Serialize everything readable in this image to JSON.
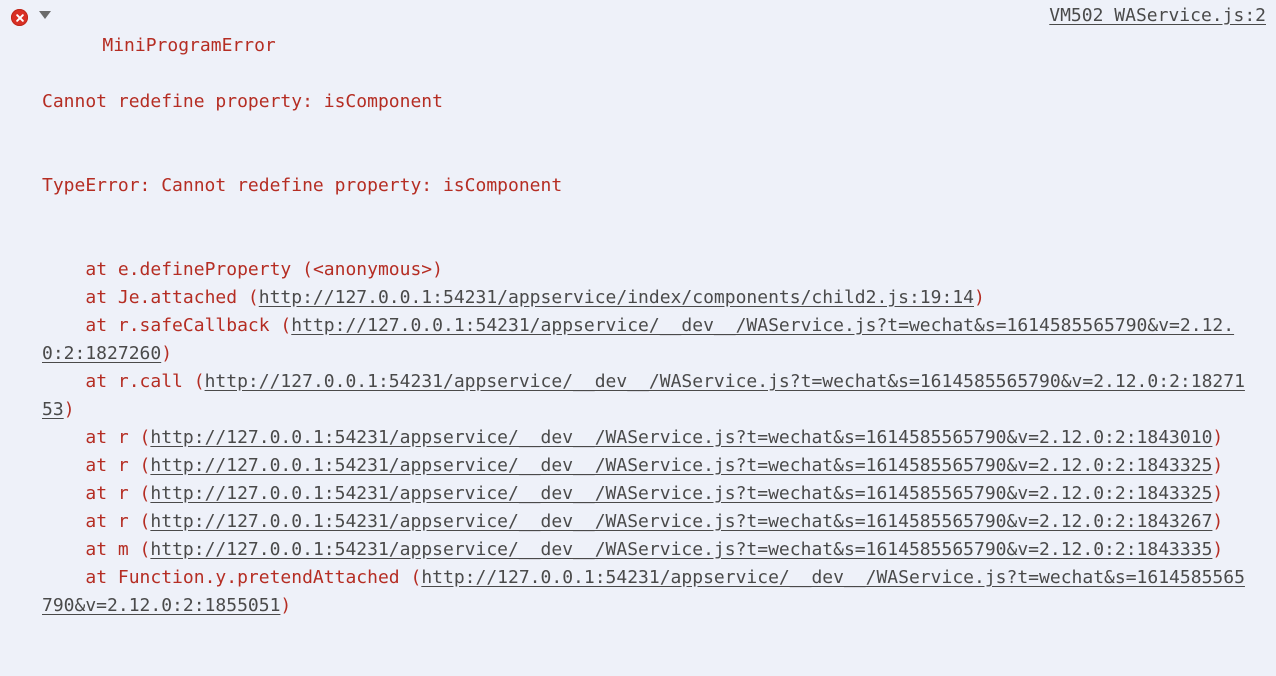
{
  "panel": {
    "type": "devtools-console-error-entry",
    "background_color": "#eef1f9",
    "error_text_color": "#b52d23",
    "link_color": "#4a4a4a",
    "icon_color": "#d93025"
  },
  "icons": {
    "error": "error-circle-x-icon",
    "disclosure": "triangle-down-icon"
  },
  "source_reference": {
    "label": "VM502 WAService.js:2"
  },
  "error": {
    "title": "MiniProgramError",
    "message": "Cannot redefine property: isComponent",
    "type_line": "TypeError: Cannot redefine property: isComponent",
    "stack": [
      {
        "prefix": "    at e.defineProperty (",
        "url": "",
        "location": "<anonymous>",
        "suffix": ")"
      },
      {
        "prefix": "    at Je.attached (",
        "url": "http://127.0.0.1:54231/appservice/index/components/child2.js:19:14",
        "suffix": ")"
      },
      {
        "prefix": "    at r.safeCallback (",
        "url": "http://127.0.0.1:54231/appservice/__dev__/WAService.js?t=wechat&s=1614585565790&v=2.12.0:2:1827260",
        "suffix": ")"
      },
      {
        "prefix": "    at r.call (",
        "url": "http://127.0.0.1:54231/appservice/__dev__/WAService.js?t=wechat&s=1614585565790&v=2.12.0:2:1827153",
        "suffix": ")"
      },
      {
        "prefix": "    at r (",
        "url": "http://127.0.0.1:54231/appservice/__dev__/WAService.js?t=wechat&s=1614585565790&v=2.12.0:2:1843010",
        "suffix": ")"
      },
      {
        "prefix": "    at r (",
        "url": "http://127.0.0.1:54231/appservice/__dev__/WAService.js?t=wechat&s=1614585565790&v=2.12.0:2:1843325",
        "suffix": ")"
      },
      {
        "prefix": "    at r (",
        "url": "http://127.0.0.1:54231/appservice/__dev__/WAService.js?t=wechat&s=1614585565790&v=2.12.0:2:1843325",
        "suffix": ")"
      },
      {
        "prefix": "    at r (",
        "url": "http://127.0.0.1:54231/appservice/__dev__/WAService.js?t=wechat&s=1614585565790&v=2.12.0:2:1843267",
        "suffix": ")"
      },
      {
        "prefix": "    at m (",
        "url": "http://127.0.0.1:54231/appservice/__dev__/WAService.js?t=wechat&s=1614585565790&v=2.12.0:2:1843335",
        "suffix": ")"
      },
      {
        "prefix": "    at Function.y.pretendAttached (",
        "url": "http://127.0.0.1:54231/appservice/__dev__/WAService.js?t=wechat&s=1614585565790&v=2.12.0:2:1855051",
        "suffix": ")"
      }
    ]
  }
}
